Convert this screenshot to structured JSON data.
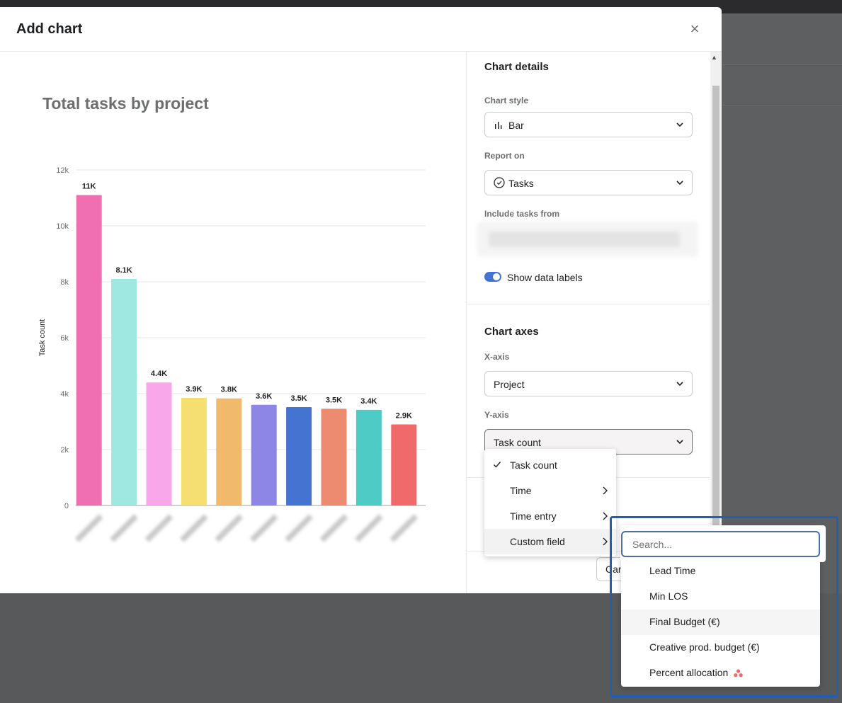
{
  "modal": {
    "title": "Add chart",
    "close_icon": "×"
  },
  "chart_data": {
    "type": "bar",
    "title": "Total tasks by project",
    "ylabel": "Task count",
    "xlabel": "",
    "ylim": [
      0,
      12000
    ],
    "yticks": [
      "0",
      "2k",
      "4k",
      "6k",
      "8k",
      "10k",
      "12k"
    ],
    "values": [
      11100,
      8100,
      4400,
      3850,
      3830,
      3600,
      3520,
      3460,
      3420,
      2900
    ],
    "data_labels": [
      "11K",
      "8.1K",
      "4.4K",
      "3.9K",
      "3.8K",
      "3.6K",
      "3.5K",
      "3.5K",
      "3.4K",
      "2.9K"
    ],
    "colors": [
      "#f06eb2",
      "#9fe8e1",
      "#f8a8ea",
      "#f5df71",
      "#f0b96b",
      "#8e86e6",
      "#4573d2",
      "#ec8b6f",
      "#4ecbc4",
      "#f06a6a"
    ],
    "grid": true,
    "legend": "none"
  },
  "panel": {
    "details_title": "Chart details",
    "chart_style_label": "Chart style",
    "chart_style_value": "Bar",
    "report_on_label": "Report on",
    "report_on_value": "Tasks",
    "include_label": "Include tasks from",
    "show_labels": "Show data labels",
    "axes_title": "Chart axes",
    "xaxis_label": "X-axis",
    "xaxis_value": "Project",
    "yaxis_label": "Y-axis",
    "yaxis_value": "Task count",
    "cancel_label": "Cancel"
  },
  "yaxis_menu": {
    "items": [
      {
        "label": "Task count",
        "selected": true,
        "submenu": false
      },
      {
        "label": "Time",
        "selected": false,
        "submenu": true
      },
      {
        "label": "Time entry",
        "selected": false,
        "submenu": true
      },
      {
        "label": "Custom field",
        "selected": false,
        "submenu": true
      }
    ]
  },
  "custom_field_menu": {
    "search_placeholder": "Search...",
    "items": [
      {
        "label": "Lead Time"
      },
      {
        "label": "Min LOS"
      },
      {
        "label": "Final Budget (€)"
      },
      {
        "label": "Creative prod. budget (€)"
      },
      {
        "label": "Percent allocation"
      }
    ]
  },
  "colors": {
    "accent": "#4573d2",
    "highlight_border": "#1e5fb8",
    "backdrop": "#58595b"
  }
}
